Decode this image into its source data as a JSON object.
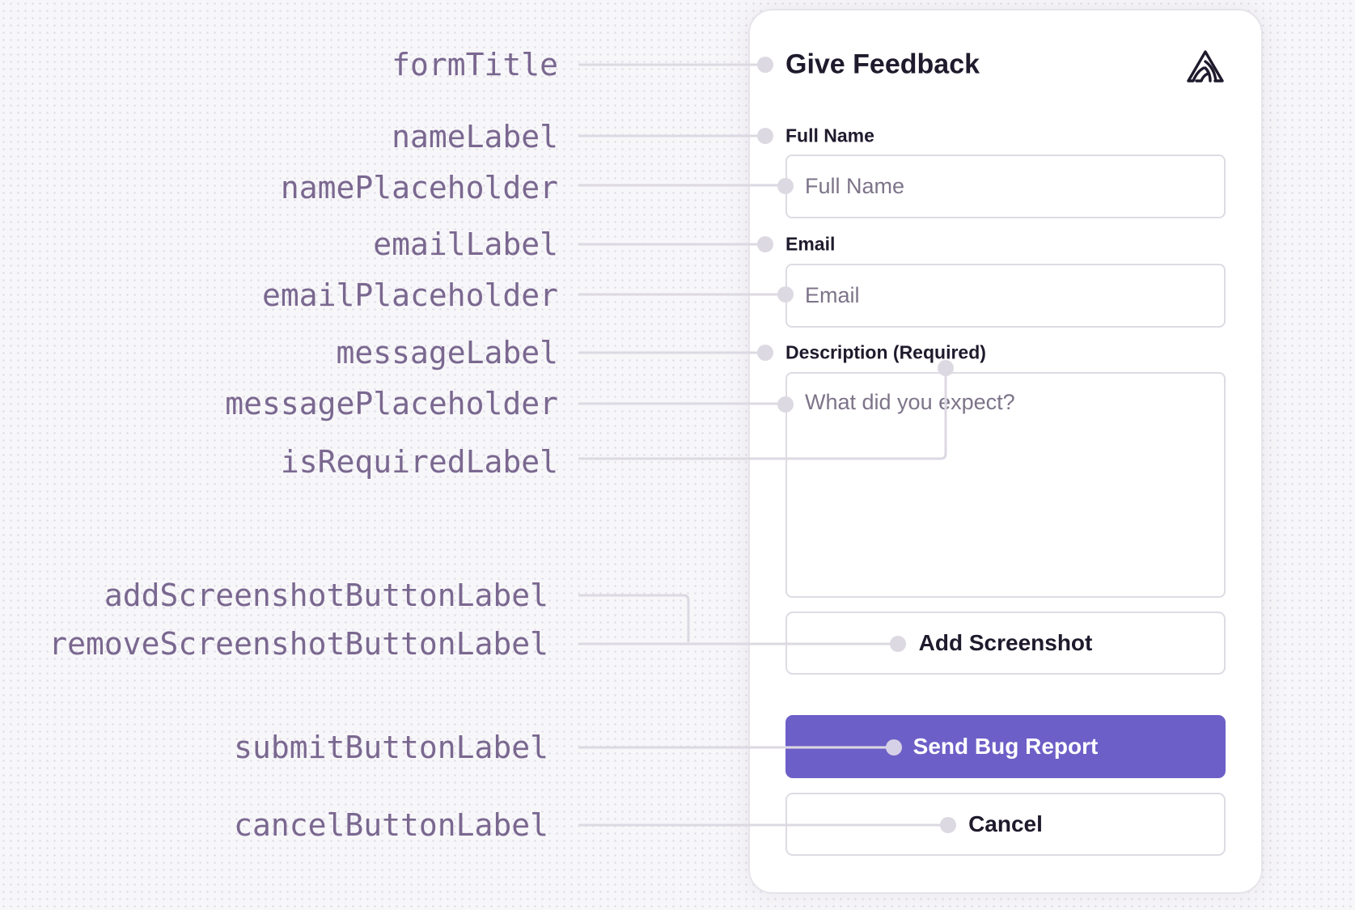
{
  "annotations": {
    "formTitle": "formTitle",
    "nameLabel": "nameLabel",
    "namePlaceholder": "namePlaceholder",
    "emailLabel": "emailLabel",
    "emailPlaceholder": "emailPlaceholder",
    "messageLabel": "messageLabel",
    "messagePlaceholder": "messagePlaceholder",
    "isRequiredLabel": "isRequiredLabel",
    "addScreenshotButtonLabel": "addScreenshotButtonLabel",
    "removeScreenshotButtonLabel": "removeScreenshotButtonLabel",
    "submitButtonLabel": "submitButtonLabel",
    "cancelButtonLabel": "cancelButtonLabel"
  },
  "form": {
    "title": "Give Feedback",
    "logo_icon": "sentry-logo-icon",
    "name_label": "Full Name",
    "name_placeholder": "Full Name",
    "name_value": "",
    "email_label": "Email",
    "email_placeholder": "Email",
    "email_value": "",
    "message_label": "Description (Required)",
    "message_placeholder": "What did you expect?",
    "message_value": "",
    "add_screenshot_label": "Add Screenshot",
    "submit_label": "Send Bug Report",
    "cancel_label": "Cancel"
  },
  "colors": {
    "accent": "#6c5fc7",
    "annotation_text": "#7a6890",
    "connector": "#dcd9e2"
  }
}
